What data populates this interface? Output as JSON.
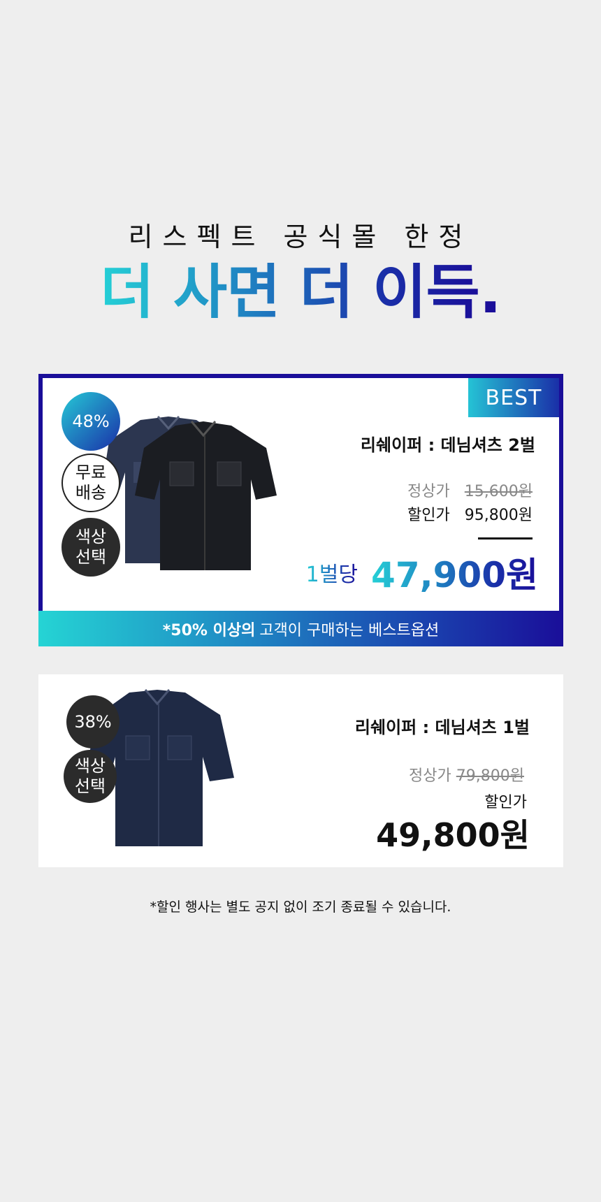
{
  "header": {
    "subtitle": "리스펙트 공식몰 한정",
    "headline": "더 사면 더 이득",
    "headline_dot": "."
  },
  "card1": {
    "tag": "BEST",
    "badges": [
      "48%",
      "무료\n배송",
      "색상\n선택"
    ],
    "title": "리쉐이퍼 : 데님셔츠 2벌",
    "regular_label": "정상가",
    "regular_price": "15,600원",
    "sale_label": "할인가",
    "sale_price": "95,800원",
    "per_unit_label": "1벌당",
    "per_unit_price": "47,900원",
    "band_bold": "*50% 이상의",
    "band_text": "고객이 구매하는 베스트옵션"
  },
  "card2": {
    "badges": [
      "38%",
      "색상\n선택"
    ],
    "title": "리쉐이퍼 : 데님셔츠 1벌",
    "regular_label": "정상가",
    "regular_price": "79,800원",
    "sale_label": "할인가",
    "sale_price": "49,800원"
  },
  "footnote": "*할인 행사는 별도 공지 없이 조기 종료될 수 있습니다.",
  "colors": {
    "accent_cyan": "#25d0d6",
    "accent_navy": "#1a0e99",
    "badge_dark": "#2b2b2b"
  }
}
